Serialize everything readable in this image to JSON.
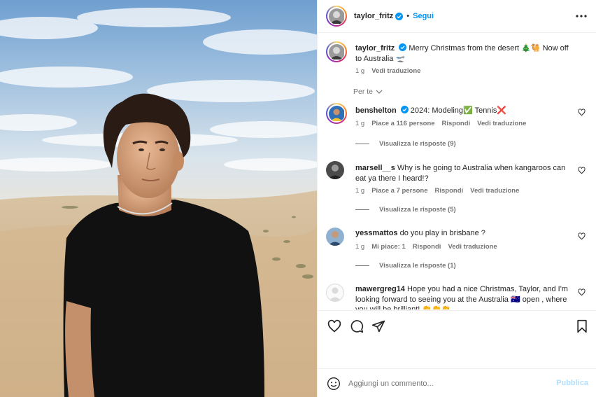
{
  "header": {
    "username": "taylor_fritz",
    "separator": "•",
    "follow_label": "Segui"
  },
  "caption": {
    "username": "taylor_fritz",
    "text": "Merry Christmas from the desert 🎄🐫 Now off to Australia 🛫",
    "time": "1 g",
    "translate": "Vedi traduzione"
  },
  "filter": {
    "label": "Per te"
  },
  "comments": [
    {
      "username": "benshelton",
      "text": "2024: Modeling✅ Tennis❌",
      "time": "1 g",
      "likes": "Piace a 116 persone",
      "reply": "Rispondi",
      "translate": "Vedi traduzione",
      "replies": "Visualizza le risposte (9)"
    },
    {
      "username": "marsell__s",
      "text": "Why is he going to Australia when kangaroos can eat ya there I heard!?",
      "time": "1 g",
      "likes": "Piace a 7 persone",
      "reply": "Rispondi",
      "translate": "Vedi traduzione",
      "replies": "Visualizza le risposte (5)"
    },
    {
      "username": "yessmattos",
      "text": "do you play in brisbane ?",
      "time": "1 g",
      "likes": "Mi piace: 1",
      "reply": "Rispondi",
      "translate": "Vedi traduzione",
      "replies": "Visualizza le risposte (1)"
    },
    {
      "username": "mawergreg14",
      "text": "Hope you had a nice Christmas, Taylor, and I'm looking forward to seeing you at the Australia 🇦🇺 open , where you will be brilliant! 👏👏👏"
    }
  ],
  "add_comment": {
    "placeholder": "Aggiungi un commento...",
    "publish_label": "Pubblica"
  },
  "colors": {
    "accent": "#0095f6",
    "publish_disabled": "#b2dffc",
    "muted": "#737373",
    "text": "#262626",
    "verified": "#0095f6"
  },
  "icons": {
    "more": "more-horizontal-icon",
    "like": "heart-icon",
    "comment": "comment-icon",
    "share": "share-icon",
    "save": "bookmark-icon",
    "emoji": "emoji-icon",
    "verified": "verified-badge-icon",
    "chevron": "chevron-down-icon"
  }
}
